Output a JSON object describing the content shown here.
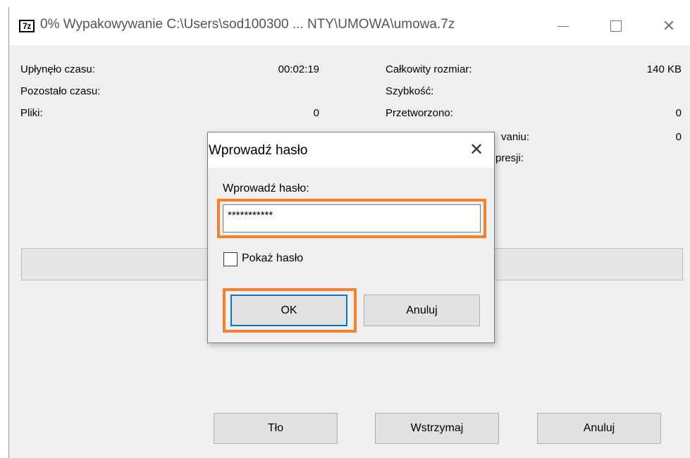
{
  "window": {
    "icon_label": "7z",
    "title": "0% Wypakowywanie C:\\Users\\sod100300 ... NTY\\UMOWA\\umowa.7z",
    "close_glyph": "✕"
  },
  "stats": {
    "elapsed_label": "Upłynęło czasu:",
    "elapsed_value": "00:02:19",
    "remaining_label": "Pozostało czasu:",
    "files_label": "Pliki:",
    "files_value": "0",
    "total_size_label": "Całkowity rozmiar:",
    "total_size_value": "140 KB",
    "speed_label": "Szybkość:",
    "processed_label": "Przetworzono:",
    "processed_value": "0",
    "row4_partial_label": "vaniu:",
    "row4_value": "0",
    "row5_partial_label": "presji:"
  },
  "progress": {
    "fraction": 0
  },
  "buttons": {
    "background": "Tło",
    "pause": "Wstrzymaj",
    "cancel": "Anuluj"
  },
  "dialog": {
    "title": "Wprowadź hasło",
    "close_glyph": "✕",
    "prompt_label": "Wprowadź hasło:",
    "password_value": "***********",
    "show_password_label": "Pokaż hasło",
    "ok_label": "OK",
    "cancel_label": "Anuluj"
  },
  "colors": {
    "highlight": "#f5822a",
    "ok_button_border": "#0078d7"
  }
}
